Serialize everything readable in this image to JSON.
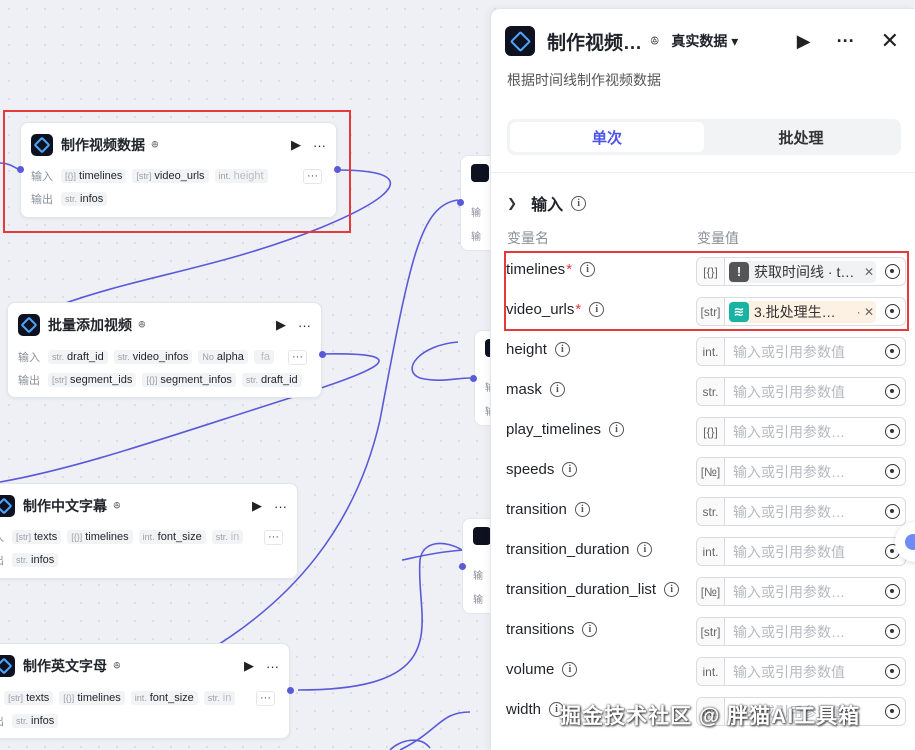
{
  "nodes": {
    "make_video": {
      "title": "制作视频数据",
      "input_label": "输入",
      "output_label": "输出",
      "inputs": [
        {
          "type": "[{}]",
          "name": "timelines"
        },
        {
          "type": "[str]",
          "name": "video_urls"
        },
        {
          "type": "int.",
          "name": "height"
        }
      ],
      "outputs": [
        {
          "type": "str.",
          "name": "infos"
        }
      ]
    },
    "add_videos": {
      "title": "批量添加视频",
      "input_label": "输入",
      "output_label": "输出",
      "inputs": [
        {
          "type": "str.",
          "name": "draft_id"
        },
        {
          "type": "str.",
          "name": "video_infos"
        },
        {
          "type": "No",
          "name": "alpha"
        },
        {
          "type": "",
          "name": "fa"
        }
      ],
      "outputs": [
        {
          "type": "[str]",
          "name": "segment_ids"
        },
        {
          "type": "[{}]",
          "name": "segment_infos"
        },
        {
          "type": "str.",
          "name": "draft_id"
        }
      ]
    },
    "cn_subtitle": {
      "title": "制作中文字幕",
      "input_label": "入",
      "output_label": "出",
      "inputs": [
        {
          "type": "[str]",
          "name": "texts"
        },
        {
          "type": "[{}]",
          "name": "timelines"
        },
        {
          "type": "int.",
          "name": "font_size"
        },
        {
          "type": "str.",
          "name": "in"
        }
      ],
      "outputs": [
        {
          "type": "str.",
          "name": "infos"
        }
      ]
    },
    "en_subtitle": {
      "title": "制作英文字母",
      "input_label": "\\",
      "output_label": "出",
      "inputs": [
        {
          "type": "[str]",
          "name": "texts"
        },
        {
          "type": "[{}]",
          "name": "timelines"
        },
        {
          "type": "int.",
          "name": "font_size"
        },
        {
          "type": "str.",
          "name": "in"
        }
      ],
      "outputs": [
        {
          "type": "str.",
          "name": "infos"
        }
      ]
    },
    "stubs": [
      {
        "l1": "输",
        "l2": "输"
      },
      {
        "l1": "输",
        "l2": "输"
      },
      {
        "l1": "输",
        "l2": "输"
      }
    ]
  },
  "panel": {
    "title": "制作视频…",
    "subtitle_glyph": "ꔮ",
    "mode": "真实数据 ▾",
    "description": "根据时间线制作视频数据",
    "tabs": [
      "单次",
      "批处理"
    ],
    "section_title": "输入",
    "col_name": "变量名",
    "col_value": "变量值",
    "placeholder": "输入或引用参数值",
    "placeholder_short": "输入或引用参数…",
    "params": [
      {
        "name": "timelines",
        "required": true,
        "type": "[{}]",
        "ref": {
          "kind": "warn",
          "badge": "!",
          "text": "获取时间线 · t…"
        }
      },
      {
        "name": "video_urls",
        "required": true,
        "type": "[str]",
        "ref": {
          "kind": "link",
          "badge": "≋",
          "text": "3.批处理生…"
        }
      },
      {
        "name": "height",
        "type": "int."
      },
      {
        "name": "mask",
        "type": "str."
      },
      {
        "name": "play_timelines",
        "type": "[{}]",
        "short": true
      },
      {
        "name": "speeds",
        "type": "[№]",
        "short": true
      },
      {
        "name": "transition",
        "type": "str.",
        "short": true
      },
      {
        "name": "transition_duration",
        "type": "int."
      },
      {
        "name": "transition_duration_list",
        "type": "[№]",
        "short": true
      },
      {
        "name": "transitions",
        "type": "[str]",
        "short": true
      },
      {
        "name": "volume",
        "type": "int."
      },
      {
        "name": "width",
        "type": "int."
      }
    ]
  },
  "watermark": "掘金技术社区 @ 胖猫AI工具箱",
  "colors": {
    "accent": "#4d53e8",
    "wire": "#5a5ad8",
    "highlight": "#e5393a"
  }
}
